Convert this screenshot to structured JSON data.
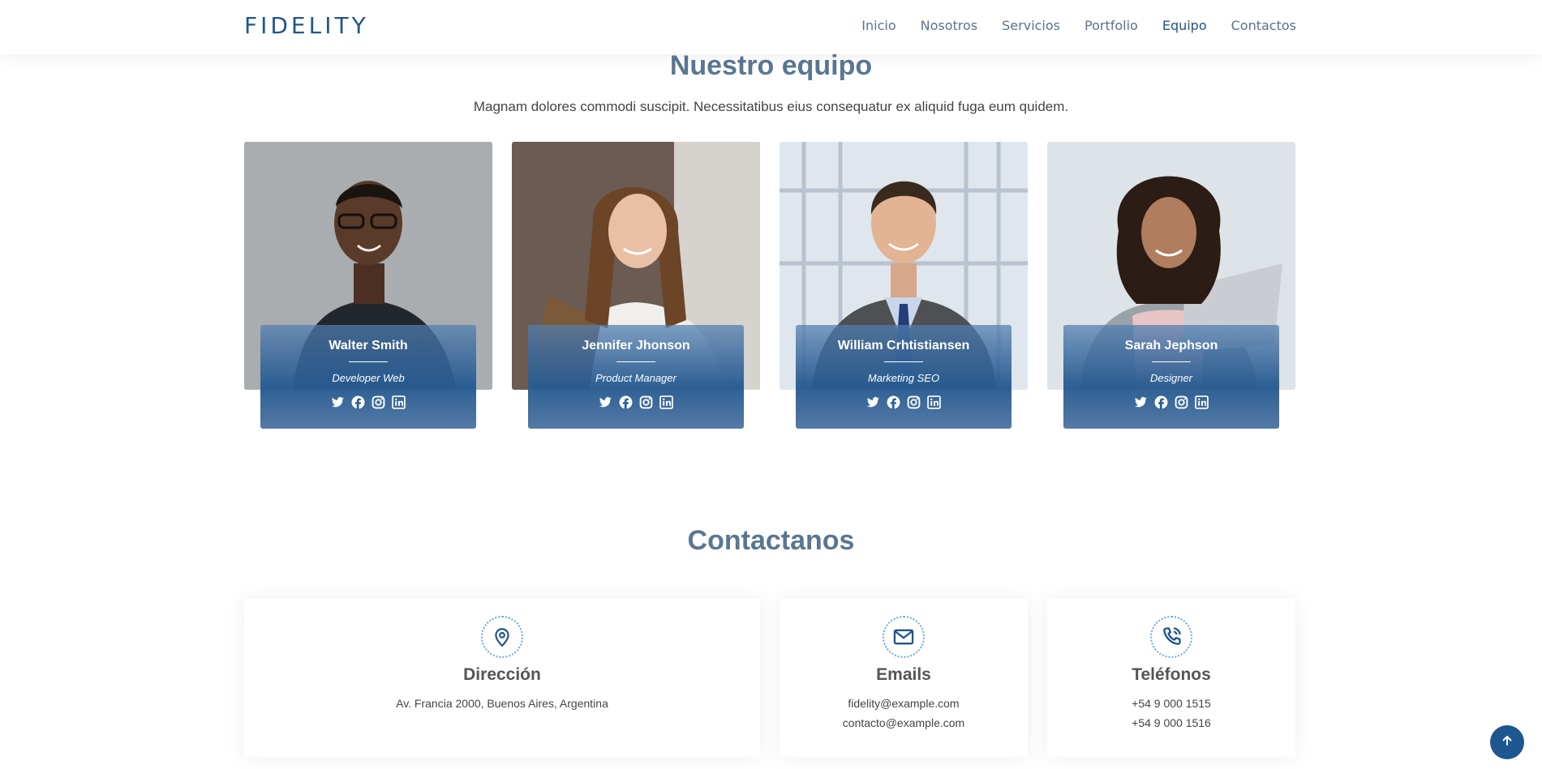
{
  "header": {
    "logo": "FIDELITY",
    "nav": [
      "Inicio",
      "Nosotros",
      "Servicios",
      "Portfolio",
      "Equipo",
      "Contactos"
    ],
    "active_nav": "Equipo"
  },
  "team": {
    "title": "Nuestro equipo",
    "subtitle": "Magnam dolores commodi suscipit. Necessitatibus eius consequatur ex aliquid fuga eum quidem.",
    "members": [
      {
        "name": "Walter Smith",
        "role": "Developer Web"
      },
      {
        "name": "Jennifer Jhonson",
        "role": "Product Manager"
      },
      {
        "name": "William Crhtistiansen",
        "role": "Marketing SEO"
      },
      {
        "name": "Sarah Jephson",
        "role": "Designer"
      }
    ],
    "social_icons": [
      "twitter-icon",
      "facebook-icon",
      "instagram-icon",
      "linkedin-icon"
    ]
  },
  "contact": {
    "title": "Contactanos",
    "cards": [
      {
        "title": "Dirección",
        "lines": [
          "Av. Francia 2000, Buenos Aires, Argentina"
        ],
        "icon": "map-pin-icon"
      },
      {
        "title": "Emails",
        "lines": [
          "fidelity@example.com",
          "contacto@example.com"
        ],
        "icon": "envelope-icon"
      },
      {
        "title": "Teléfonos",
        "lines": [
          "+54 9 000 1515",
          "+54 9 000 1516"
        ],
        "icon": "phone-icon"
      }
    ]
  },
  "colors": {
    "brand": "#20568c",
    "title": "#5a7693",
    "nav": "#5b728f"
  }
}
